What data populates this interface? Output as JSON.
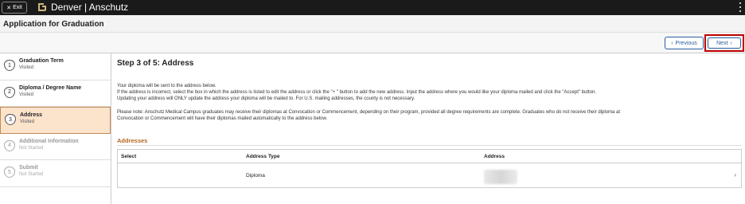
{
  "topbar": {
    "exit_label": "Exit",
    "brand": "Denver | Anschutz",
    "icons": {
      "exit": "close-icon",
      "logo": "cu-logo",
      "menu": "kebab-menu-icon"
    }
  },
  "page": {
    "title": "Application for Graduation"
  },
  "nav": {
    "previous_label": "Previous",
    "next_label": "Next"
  },
  "steps": [
    {
      "num": "1",
      "title": "Graduation Term",
      "status": "Visited",
      "state": "visited"
    },
    {
      "num": "2",
      "title": "Diploma / Degree Name",
      "status": "Visited",
      "state": "visited"
    },
    {
      "num": "3",
      "title": "Address",
      "status": "Visited",
      "state": "active"
    },
    {
      "num": "4",
      "title": "Additional Information",
      "status": "Not Started",
      "state": "disabled"
    },
    {
      "num": "5",
      "title": "Submit",
      "status": "Not Started",
      "state": "disabled"
    }
  ],
  "main": {
    "heading": "Step 3 of 5: Address",
    "para1_line1": "Your diploma will be sent to the address below.",
    "para1_line2": "If the address is incorrect, select the box in which the address is listed to edit the address or click the \"+ \" button to add the new address. Input the address where you would like your diploma mailed and click the \"Accept\" button.",
    "para1_line3": "Updating your address will ONLY update the address your diploma will be mailed to. For U.S. mailing addresses, the county is not necessary.",
    "para2_line1": "Please note: Anschutz Medical Campus graduates may receive their diplomas at Convocation or Commencement, depending on their program, provided all degree requirements are complete. Graduates who do not receive their diploma at",
    "para2_line2": "Convocation or Commencement will have their diplomas mailed automatically to the address below.",
    "addresses_heading": "Addresses",
    "table": {
      "columns": [
        "Select",
        "Address Type",
        "Address"
      ],
      "rows": [
        {
          "select": "",
          "type": "Diploma",
          "address": ""
        }
      ]
    }
  },
  "colors": {
    "accent": "#2a5f9e",
    "active_step_bg": "#fbe3cc",
    "section_heading": "#b5651d",
    "highlight_box": "#c00000"
  }
}
